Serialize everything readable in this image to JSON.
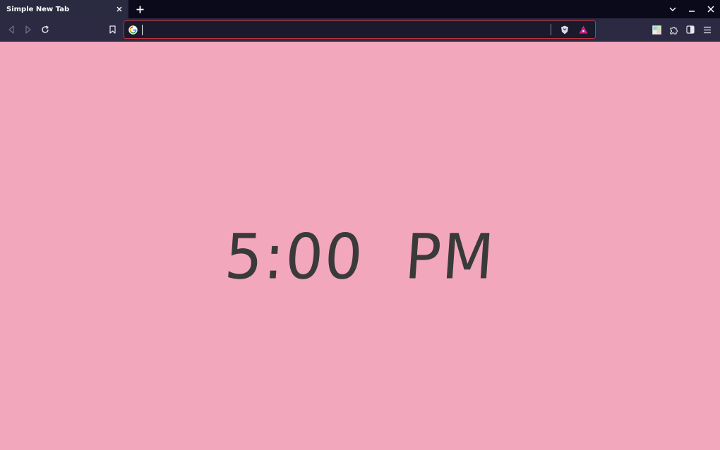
{
  "tabstrip": {
    "active_tab_title": "Simple New Tab"
  },
  "toolbar": {
    "url_value": ""
  },
  "page": {
    "clock_text": "5:00 PM"
  },
  "colors": {
    "page_background": "#f2a7bd",
    "clock_text": "#3a3a3a",
    "tabstrip_bg": "#0b0a1a",
    "toolbar_bg": "#2b2a42",
    "urlbar_border": "#c0343c"
  },
  "icons": {
    "back": "back-arrow-icon",
    "forward": "forward-arrow-icon",
    "reload": "reload-icon",
    "bookmark": "bookmark-icon",
    "google": "google-icon",
    "shield": "brave-shields-icon",
    "rewards": "brave-rewards-icon",
    "extension_tile": "extension-tile-icon",
    "extensions": "extensions-puzzle-icon",
    "sidebar": "sidebar-icon",
    "menu": "hamburger-menu-icon"
  }
}
